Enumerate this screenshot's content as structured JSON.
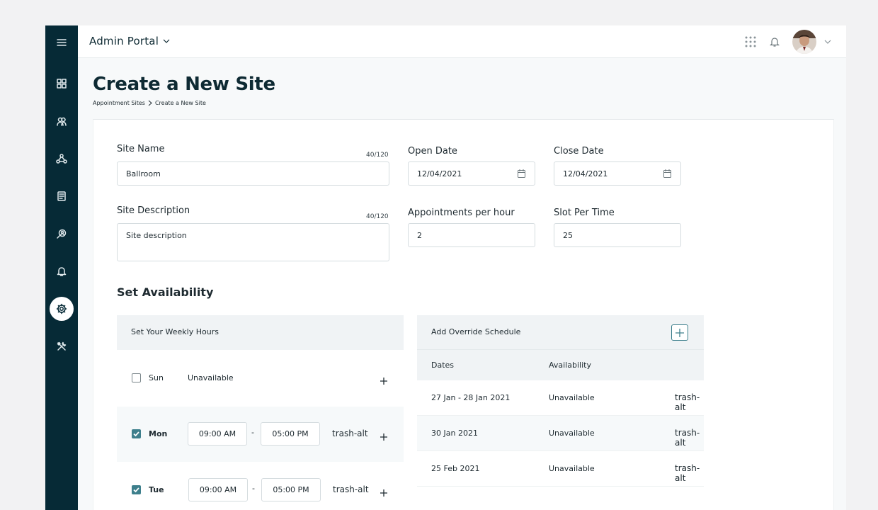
{
  "header": {
    "portal_title": "Admin Portal"
  },
  "sidebar": {
    "items": [
      {
        "icon": "menu-icon"
      },
      {
        "icon": "grid-icon"
      },
      {
        "icon": "users-icon"
      },
      {
        "icon": "network-icon"
      },
      {
        "icon": "documents-icon"
      },
      {
        "icon": "search-user-icon"
      },
      {
        "icon": "bell-icon"
      },
      {
        "icon": "gear-icon",
        "active": true
      },
      {
        "icon": "tools-icon"
      }
    ]
  },
  "page": {
    "title": "Create a New Site",
    "breadcrumb": [
      "Appointment Sites",
      "Create a New Site"
    ]
  },
  "form": {
    "site_name": {
      "label": "Site Name",
      "value": "Ballroom",
      "counter": "40/120"
    },
    "site_description": {
      "label": "Site Description",
      "value": "Site description",
      "counter": "40/120"
    },
    "open_date": {
      "label": "Open Date",
      "value": "12/04/2021"
    },
    "close_date": {
      "label": "Close Date",
      "value": "12/04/2021"
    },
    "appointments_per_hour": {
      "label": "Appointments per hour",
      "value": "2"
    },
    "slot_per_time": {
      "label": "Slot Per Time",
      "value": "25"
    }
  },
  "availability": {
    "title": "Set Availability",
    "weekly_header": "Set Your Weekly Hours",
    "days": [
      {
        "name": "Sun",
        "checked": false,
        "status": "Unavailable"
      },
      {
        "name": "Mon",
        "checked": true,
        "start": "09:00 AM",
        "end": "05:00 PM",
        "separator": "-",
        "trash_label": "trash-alt"
      },
      {
        "name": "Tue",
        "checked": true,
        "start": "09:00 AM",
        "end": "05:00 PM",
        "separator": "-",
        "trash_label": "trash-alt"
      }
    ]
  },
  "override": {
    "header": "Add Override Schedule",
    "columns": [
      "Dates",
      "Availability"
    ],
    "rows": [
      {
        "dates": "27 Jan - 28 Jan 2021",
        "availability": "Unavailable",
        "trash_label": "trash-alt"
      },
      {
        "dates": "30 Jan 2021",
        "availability": "Unavailable",
        "trash_label": "trash-alt"
      },
      {
        "dates": "25 Feb 2021",
        "availability": "Unavailable",
        "trash_label": "trash-alt"
      }
    ]
  },
  "colors": {
    "sidebar_bg": "#062a36",
    "accent": "#3d7f8c",
    "page_bg": "#f7f9fa"
  }
}
